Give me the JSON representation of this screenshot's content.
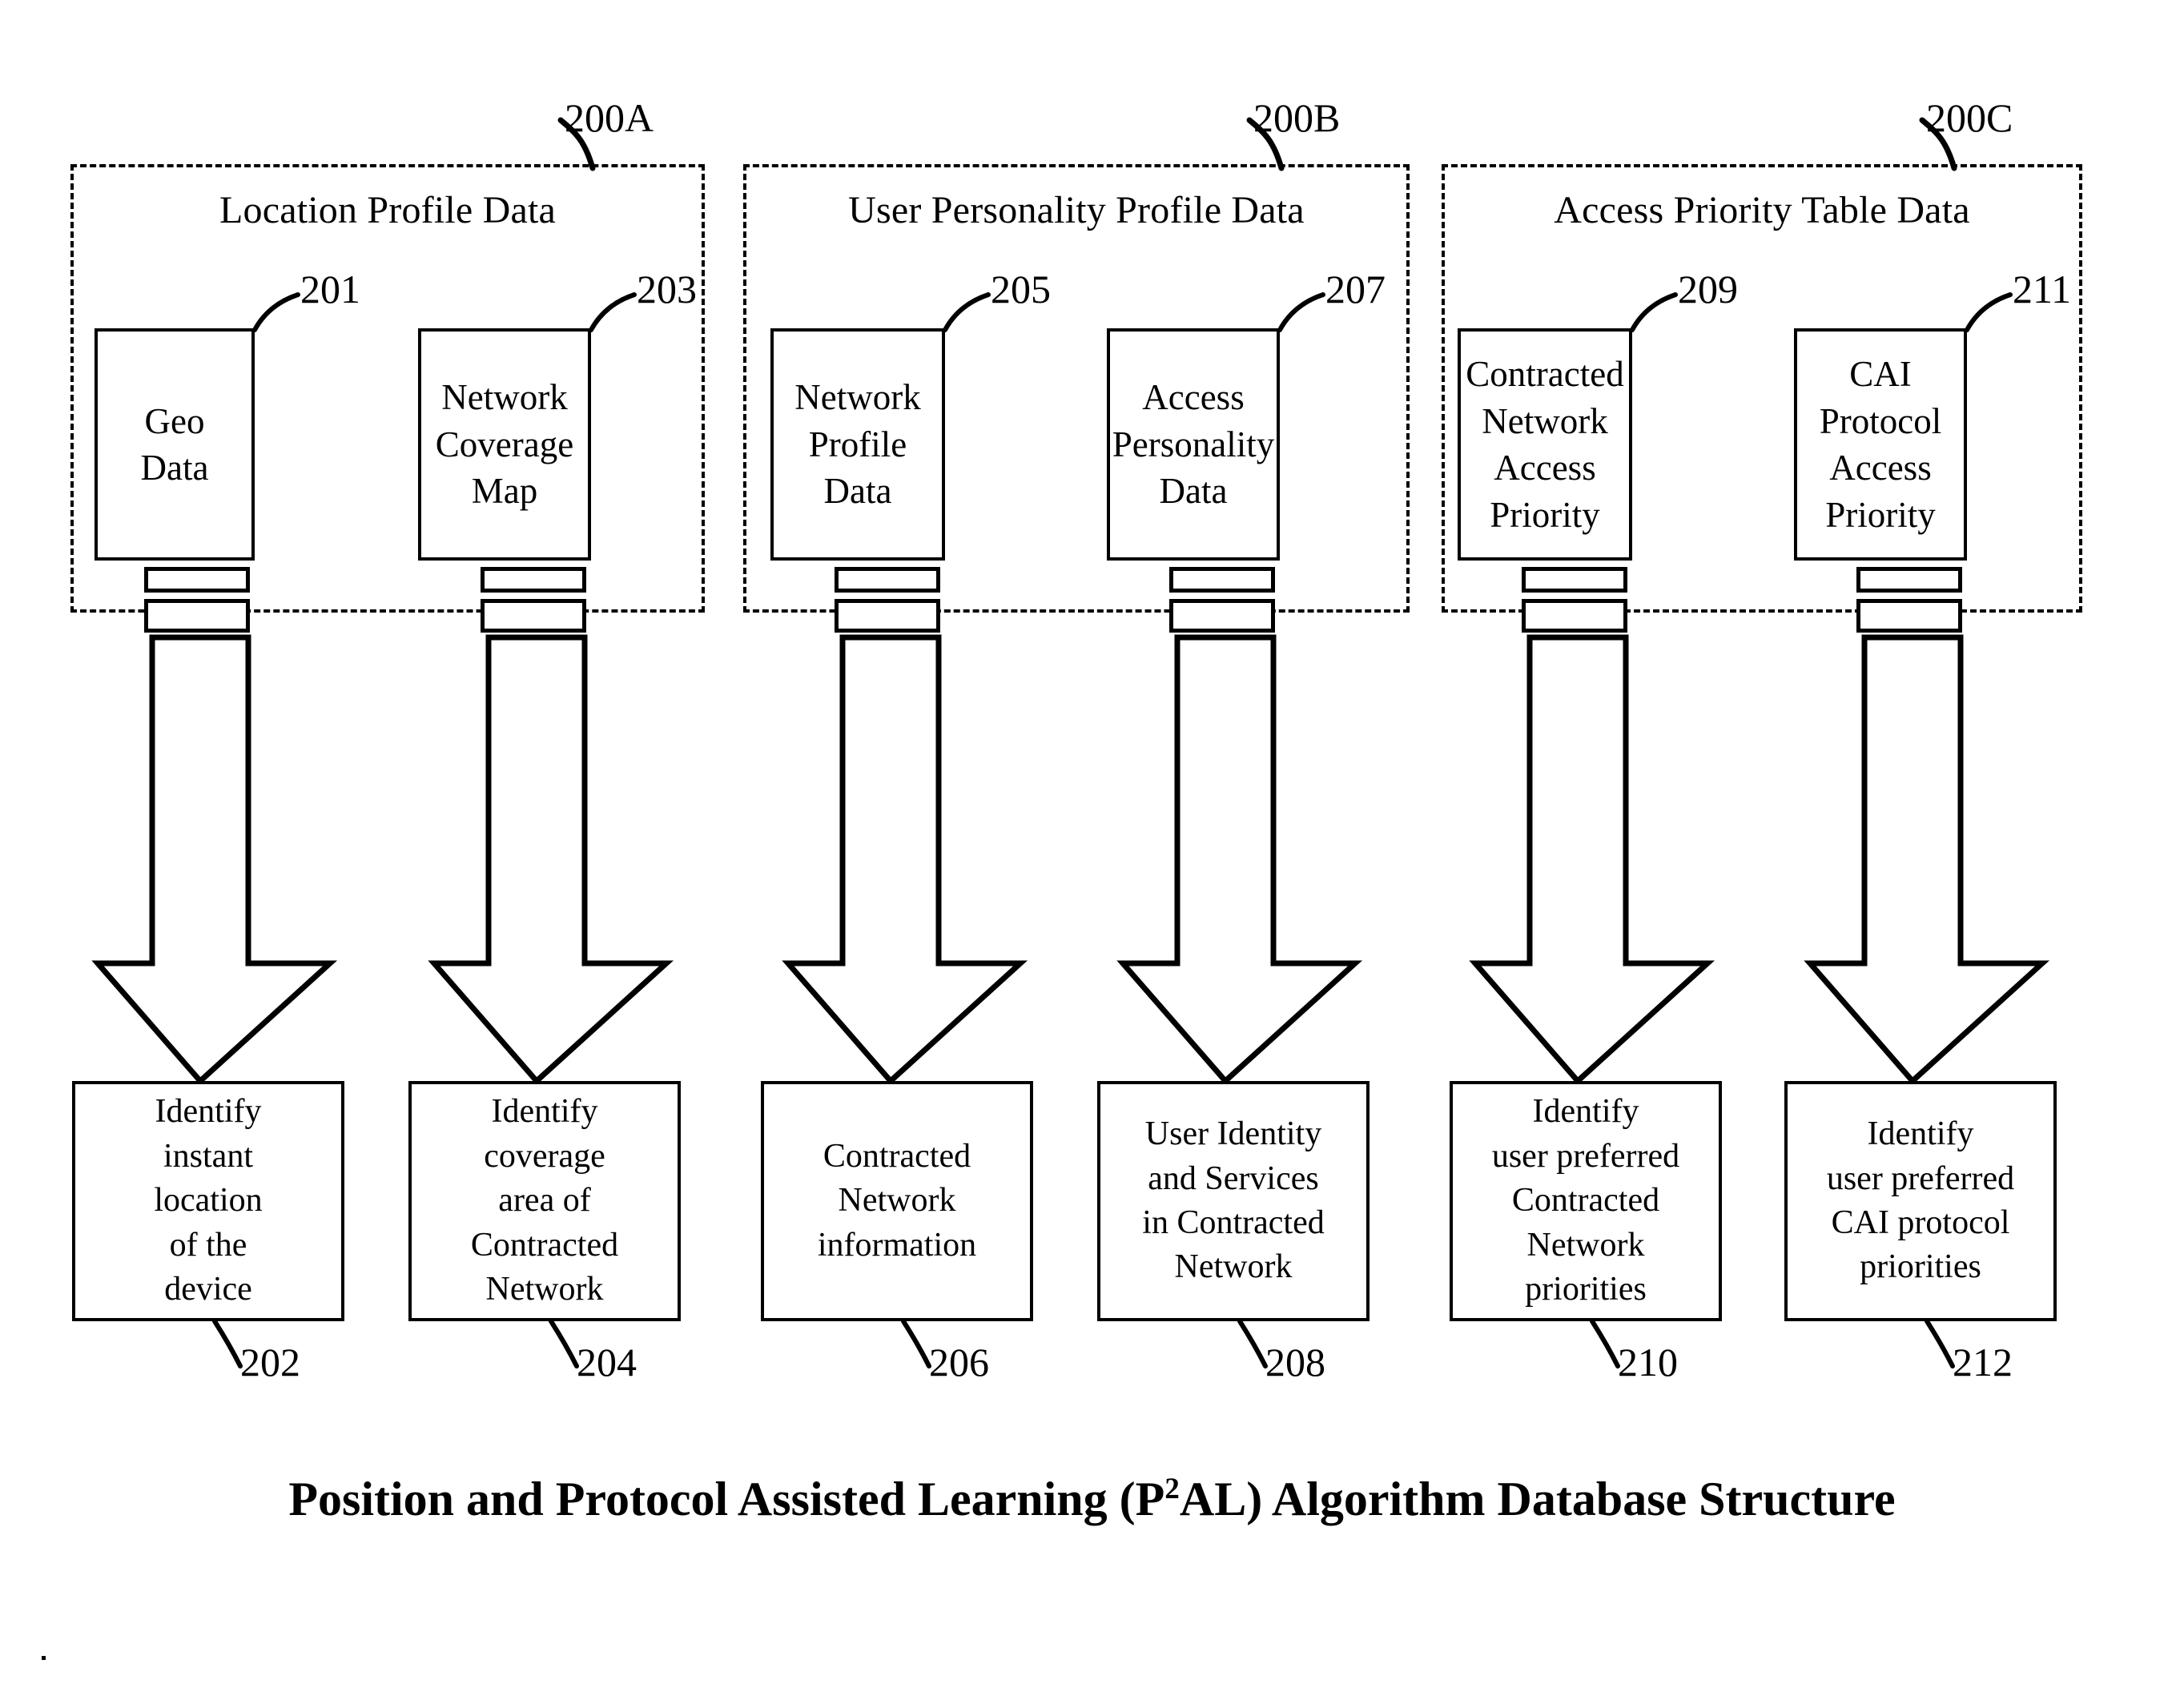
{
  "figure": {
    "caption_prefix": "Position and Protocol Assisted Learning (P",
    "caption_sup": "2",
    "caption_suffix": "AL) Algorithm Database Structure"
  },
  "groups": [
    {
      "ref": "200A",
      "title": "Location Profile Data",
      "sources": [
        {
          "ref": "201",
          "label": "Geo\nData"
        },
        {
          "ref": "203",
          "label": "Network\nCoverage\nMap"
        }
      ]
    },
    {
      "ref": "200B",
      "title": "User Personality Profile Data",
      "sources": [
        {
          "ref": "205",
          "label": "Network\nProfile\nData"
        },
        {
          "ref": "207",
          "label": "Access\nPersonality\nData"
        }
      ]
    },
    {
      "ref": "200C",
      "title": "Access Priority Table Data",
      "sources": [
        {
          "ref": "209",
          "label": "Contracted\nNetwork\nAccess\nPriority"
        },
        {
          "ref": "211",
          "label": "CAI\nProtocol\nAccess\nPriority"
        }
      ]
    }
  ],
  "results": [
    {
      "ref": "202",
      "label": "Identify\ninstant\nlocation\nof the\ndevice"
    },
    {
      "ref": "204",
      "label": "Identify\ncoverage\narea of\nContracted\nNetwork"
    },
    {
      "ref": "206",
      "label": "Contracted\nNetwork\ninformation"
    },
    {
      "ref": "208",
      "label": "User Identity\nand Services\nin Contracted\nNetwork"
    },
    {
      "ref": "210",
      "label": "Identify\nuser preferred\nContracted\nNetwork\npriorities"
    },
    {
      "ref": "212",
      "label": "Identify\nuser preferred\nCAI protocol\npriorities"
    }
  ],
  "colors": {
    "ink": "#000000",
    "paper": "#ffffff"
  }
}
